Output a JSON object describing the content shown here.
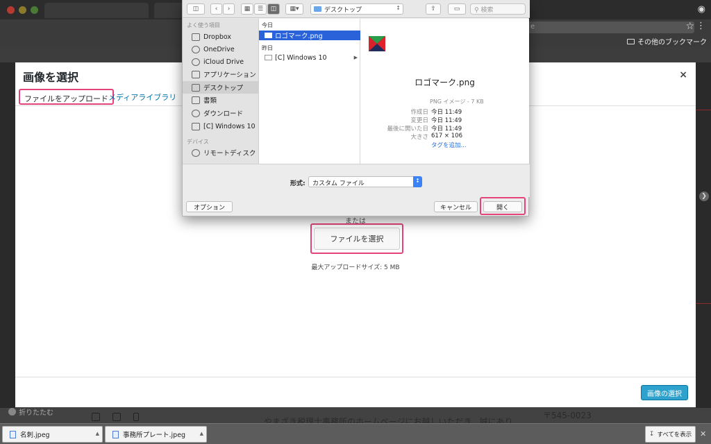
{
  "browser": {
    "bookmarks_folder": "その他のブックマーク",
    "address_fragment": "e"
  },
  "background": {
    "fold_label": "折りたたむ",
    "body_text": "やまざき税理士事務所のホームページにお越しいただき、誠にあり",
    "postal_code": "〒545-0023"
  },
  "modal": {
    "title": "画像を選択",
    "close_glyph": "×",
    "tabs": [
      "ファイルをアップロード",
      "メディアライブラリ"
    ],
    "or_text": "または",
    "select_file_label": "ファイルを選択",
    "max_upload": "最大アップロードサイズ: 5 MB",
    "select_image_label": "画像の選択"
  },
  "dialog": {
    "location": "デスクトップ",
    "search_placeholder": "検索",
    "sidebar": {
      "favorites_heading": "よく使う項目",
      "favorites": [
        "Dropbox",
        "OneDrive",
        "iCloud Drive",
        "アプリケーション",
        "デスクトップ",
        "書類",
        "ダウンロード",
        "[C] Windows 10"
      ],
      "devices_heading": "デバイス",
      "devices": [
        "リモートディスク"
      ]
    },
    "column": {
      "today_heading": "今日",
      "today_items": [
        "ロゴマーク.png"
      ],
      "yesterday_heading": "昨日",
      "yesterday_items": [
        "[C] Windows 10"
      ]
    },
    "preview": {
      "file_name": "ロゴマーク.png",
      "type": "PNG イメージ - 7 KB",
      "meta": [
        {
          "key": "作成日",
          "value": "今日 11:49"
        },
        {
          "key": "変更日",
          "value": "今日 11:49"
        },
        {
          "key": "最後に開いた日",
          "value": "今日 11:49"
        },
        {
          "key": "大きさ",
          "value": "617 × 106"
        }
      ],
      "add_tags": "タグを追加..."
    },
    "format_label": "形式:",
    "format_value": "カスタム ファイル",
    "options_label": "オプション",
    "cancel_label": "キャンセル",
    "open_label": "開く"
  },
  "downloads": {
    "items": [
      "名刺.jpeg",
      "事務所プレート.jpeg"
    ],
    "show_all": "すべてを表示"
  },
  "colors": {
    "highlight": "#e4437a",
    "link": "#0073aa",
    "primary_button": "#2ea2cc",
    "selection": "#2962d9"
  }
}
